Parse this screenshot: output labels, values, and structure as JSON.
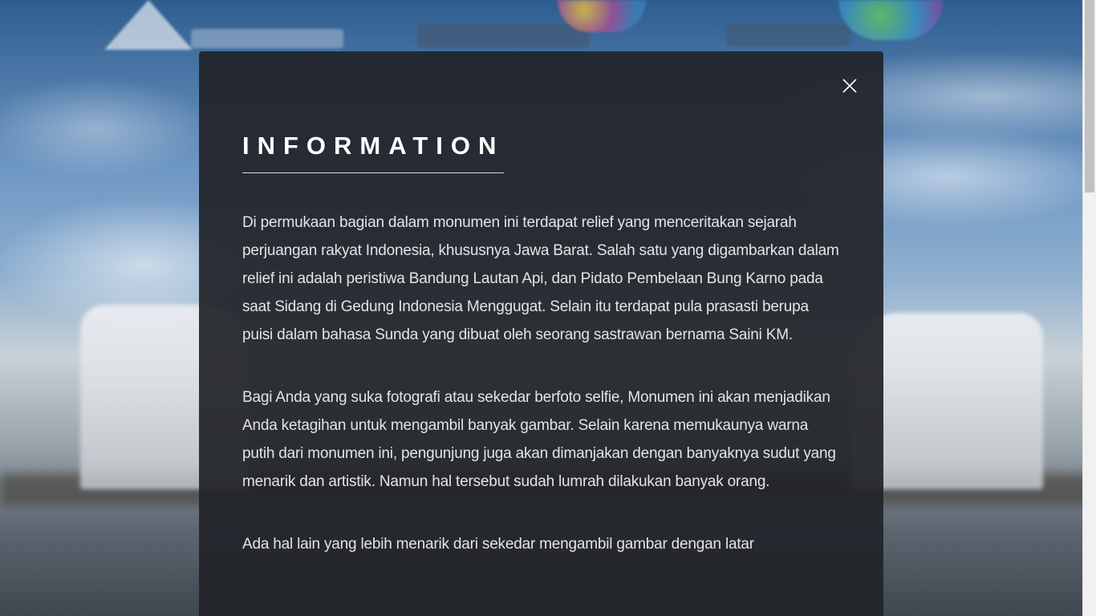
{
  "modal": {
    "title": "INFORMATION",
    "close_icon": "close-icon",
    "paragraphs": [
      "Di permukaan bagian dalam monumen ini terdapat relief yang menceritakan sejarah perjuangan rakyat Indonesia, khususnya Jawa Barat. Salah satu yang digambarkan dalam relief ini adalah peristiwa Bandung Lautan Api, dan Pidato Pembelaan Bung Karno pada saat Sidang di Gedung Indonesia Menggugat. Selain itu terdapat pula prasasti berupa puisi dalam bahasa Sunda yang dibuat oleh seorang sastrawan bernama Saini KM.",
      "Bagi Anda yang suka fotografi atau sekedar berfoto selfie, Monumen ini akan menjadikan Anda ketagihan untuk mengambil banyak gambar. Selain karena memukaunya warna putih dari monumen ini, pengunjung juga akan dimanjakan dengan banyaknya sudut yang menarik dan artistik. Namun hal tersebut sudah lumrah dilakukan banyak orang.",
      "Ada hal lain yang lebih menarik dari sekedar mengambil gambar dengan latar"
    ]
  },
  "colors": {
    "modal_background": "#212429",
    "title_color": "#ffffff",
    "text_color": "#e4e4e4",
    "scrollbar_track": "#f1f1f1",
    "scrollbar_thumb": "#c1c1c1"
  }
}
